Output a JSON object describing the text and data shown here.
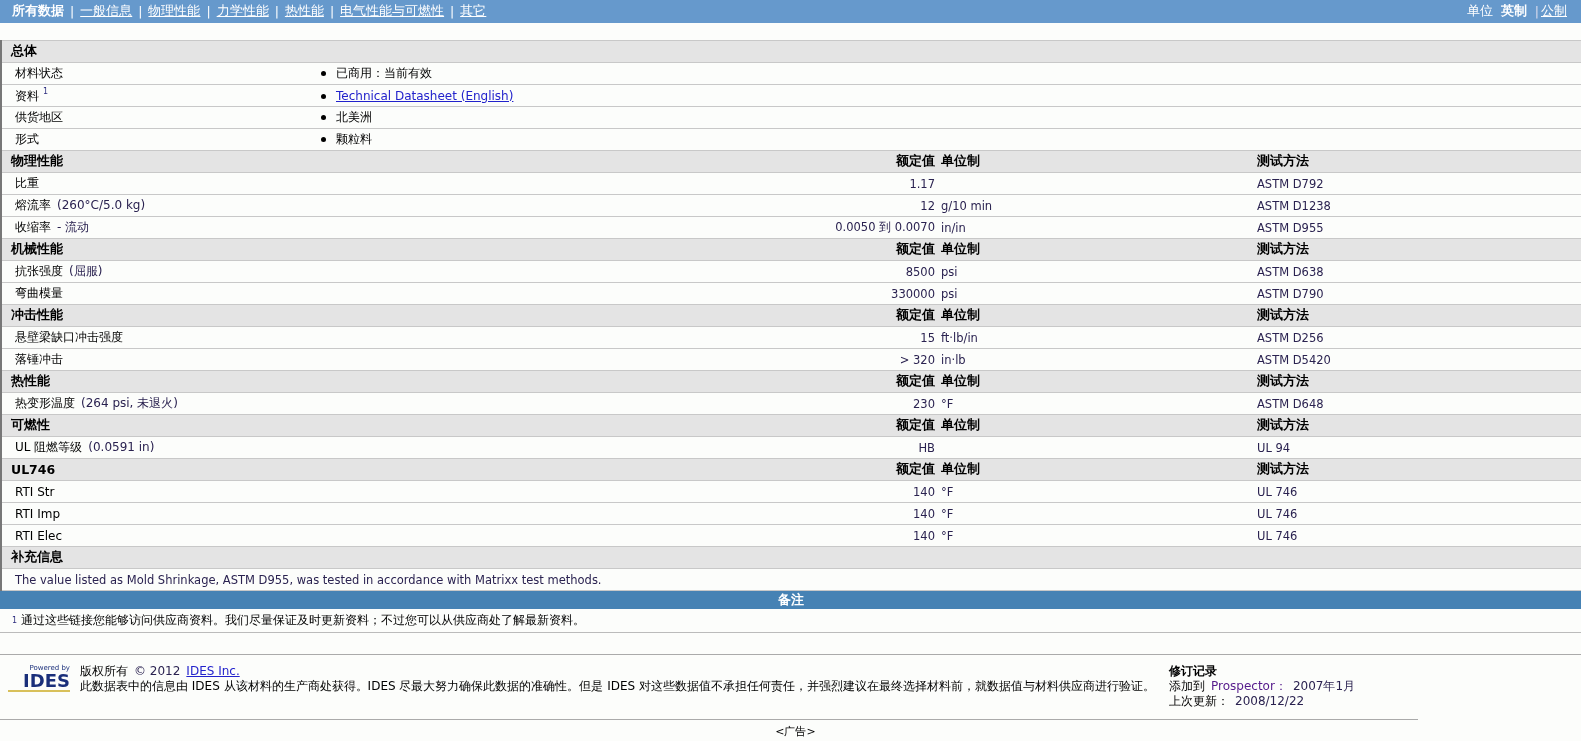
{
  "nav": {
    "separator": "|",
    "tabs": [
      {
        "label": "所有数据",
        "selected": true
      },
      {
        "label": "一般信息",
        "selected": false
      },
      {
        "label": "物理性能",
        "selected": false
      },
      {
        "label": "力学性能",
        "selected": false
      },
      {
        "label": "热性能",
        "selected": false
      },
      {
        "label": "电气性能与可燃性",
        "selected": false
      },
      {
        "label": "其它",
        "selected": false
      }
    ],
    "units_label": "单位",
    "units": [
      {
        "label": "英制",
        "selected": true
      },
      {
        "label": "公制",
        "selected": false
      }
    ]
  },
  "sections": [
    {
      "title": "总体",
      "kind": "list",
      "rows": [
        {
          "name": "材料状态",
          "value": "已商用：当前有效",
          "link": false
        },
        {
          "name": "资料",
          "footnote": "1",
          "value": "Technical Datasheet (English)",
          "link": true
        },
        {
          "name": "供货地区",
          "value": "北美洲",
          "link": false
        },
        {
          "name": "形式",
          "value": "颗粒料",
          "link": false
        }
      ]
    },
    {
      "title": "物理性能",
      "kind": "properties",
      "columns": [
        "额定值",
        "单位制",
        "测试方法"
      ],
      "rows": [
        {
          "name": "比重",
          "value": "1.17",
          "method": "ASTM D792"
        },
        {
          "name": "熔流率",
          "condition": "(260°C/5.0 kg)",
          "value": "12",
          "unit": "g/10 min",
          "method": "ASTM D1238"
        },
        {
          "name": "收缩率",
          "condition": "- 流动",
          "value": "0.0050 到  0.0070",
          "unit": "in/in",
          "method": "ASTM D955"
        }
      ]
    },
    {
      "title": "机械性能",
      "kind": "properties",
      "columns": [
        "额定值",
        "单位制",
        "测试方法"
      ],
      "rows": [
        {
          "name": "抗张强度",
          "condition": "(屈服)",
          "value": "8500",
          "unit": "psi",
          "method": "ASTM D638"
        },
        {
          "name": "弯曲模量",
          "value": "330000",
          "unit": "psi",
          "method": "ASTM D790"
        }
      ]
    },
    {
      "title": "冲击性能",
      "kind": "properties",
      "columns": [
        "额定值",
        "单位制",
        "测试方法"
      ],
      "rows": [
        {
          "name": "悬壁梁缺口冲击强度",
          "value": "15",
          "unit": "ft·lb/in",
          "method": "ASTM D256"
        },
        {
          "name": "落锤冲击",
          "value": "> 320",
          "unit": "in·lb",
          "method": "ASTM D5420"
        }
      ]
    },
    {
      "title": "热性能",
      "kind": "properties",
      "columns": [
        "额定值",
        "单位制",
        "测试方法"
      ],
      "rows": [
        {
          "name": "热变形温度",
          "condition": "(264 psi, 未退火)",
          "value": "230",
          "unit": "°F",
          "method": "ASTM D648"
        }
      ]
    },
    {
      "title": "可燃性",
      "kind": "properties",
      "columns": [
        "额定值",
        "单位制",
        "测试方法"
      ],
      "rows": [
        {
          "name": "UL 阻燃等级",
          "condition": "(0.0591 in)",
          "value": "HB",
          "method": "UL 94"
        }
      ]
    },
    {
      "title": "UL746",
      "kind": "properties",
      "columns": [
        "额定值",
        "单位制",
        "测试方法"
      ],
      "rows": [
        {
          "name": "RTI Str",
          "value": "140",
          "unit": "°F",
          "method": "UL 746"
        },
        {
          "name": "RTI Imp",
          "value": "140",
          "unit": "°F",
          "method": "UL 746"
        },
        {
          "name": "RTI Elec",
          "value": "140",
          "unit": "°F",
          "method": "UL 746"
        }
      ]
    },
    {
      "title": "补充信息",
      "kind": "note",
      "rows": [
        {
          "text": "The value listed as Mold Shrinkage, ASTM D955, was tested in accordance with Matrixx test methods."
        }
      ]
    }
  ],
  "remarks": {
    "title": "备注",
    "notes": [
      {
        "mark": "1",
        "text": "通过这些链接您能够访问供应商资料。我们尽量保证及时更新资料；不过您可以从供应商处了解最新资料。"
      }
    ]
  },
  "footer": {
    "logo_top": "Powered by",
    "logo_name": "IDES",
    "copyright_label": "版权所有",
    "copyright_year": "© 2012",
    "copyright_link": "IDES Inc.",
    "disclaimer": "此数据表中的信息由  IDES 从该材料的生产商处获得。IDES 尽最大努力确保此数据的准确性。但是  IDES 对这些数据值不承担任何责任，并强烈建议在最终选择材料前，就数据值与材料供应商进行验证。",
    "revision": {
      "title": "修订记录",
      "added_label": "添加到",
      "added_source": "Prospector：",
      "added_date": "2007年1月",
      "updated_label": "上次更新：",
      "updated_date": "2008/12/22"
    }
  },
  "ad": "<广告>"
}
